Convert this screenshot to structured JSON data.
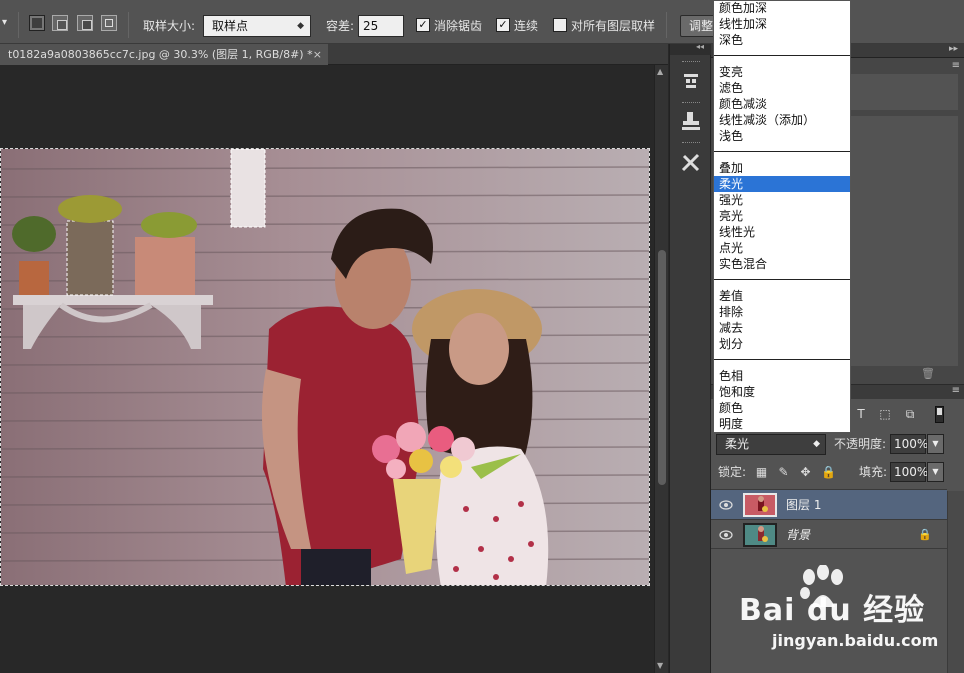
{
  "options_bar": {
    "sample_size_label": "取样大小:",
    "sample_size_value": "取样点",
    "tolerance_label": "容差:",
    "tolerance_value": "25",
    "antialias_label": "消除锯齿",
    "antialias_checked": true,
    "contiguous_label": "连续",
    "contiguous_checked": true,
    "all_layers_label": "对所有图层取样",
    "all_layers_checked": false,
    "refine_button_label": "调整"
  },
  "document_tab": {
    "title": "t0182a9a0803865cc7c.jpg @ 30.3% (图层 1, RGB/8#) *",
    "close_glyph": "×"
  },
  "blend_mode_menu": {
    "groups": [
      [
        "颜色加深",
        "线性加深",
        "深色"
      ],
      [
        "变亮",
        "滤色",
        "颜色减淡",
        "线性减淡（添加）",
        "浅色"
      ],
      [
        "叠加",
        "柔光",
        "强光",
        "亮光",
        "线性光",
        "点光",
        "实色混合"
      ],
      [
        "差值",
        "排除",
        "减去",
        "划分"
      ],
      [
        "色相",
        "饱和度",
        "颜色",
        "明度"
      ]
    ],
    "highlighted": "柔光"
  },
  "layers_panel": {
    "blend_mode": "柔光",
    "opacity_label": "不透明度:",
    "opacity_value": "100%",
    "lock_label": "锁定:",
    "fill_label": "填充:",
    "fill_value": "100%",
    "layers": [
      {
        "name": "图层 1",
        "selected": true,
        "visible": true,
        "locked": false
      },
      {
        "name": "背景",
        "selected": false,
        "visible": true,
        "locked": true
      }
    ]
  },
  "watermark": {
    "logo": "Bai du 经验",
    "url": "jingyan.baidu.com"
  },
  "colors": {
    "accent": "#2b74d6",
    "selected_layer": "#54657e",
    "panel_bg": "#535353",
    "canvas_bg": "#282828"
  }
}
